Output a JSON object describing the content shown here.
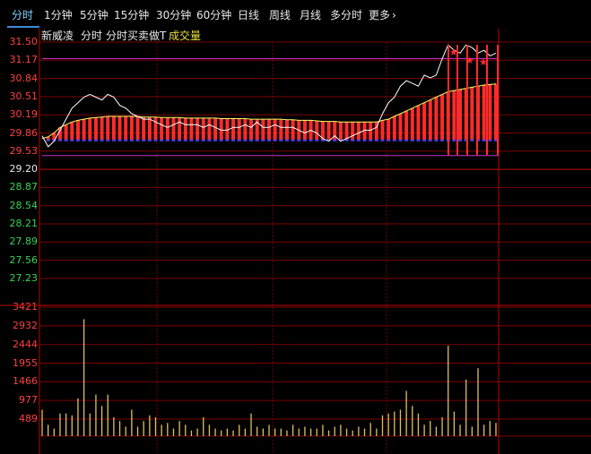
{
  "tabs": {
    "items": [
      "分时",
      "1分钟",
      "5分钟",
      "15分钟",
      "30分钟",
      "60分钟",
      "日线",
      "周线",
      "月线",
      "多分时",
      "更多"
    ],
    "active_index": 0,
    "more_arrow": "chevron-right-icon"
  },
  "info": {
    "stock_name": "新威凌",
    "view": "分时",
    "indicator": "分时买卖做T",
    "volume_label": "成交量"
  },
  "colors": {
    "up": "#ff2b2b",
    "down": "#39d353",
    "price_line": "#ffffff",
    "avg_line": "#ffff66",
    "grid": "#7a0000",
    "band": "#cc33cc",
    "volume": "#e0c060"
  },
  "price_axis": {
    "ticks": [
      "31.50",
      "31.17",
      "30.84",
      "30.51",
      "30.19",
      "29.86",
      "29.53",
      "29.20",
      "28.87",
      "28.54",
      "28.21",
      "27.89",
      "27.56",
      "27.23"
    ],
    "tick_colors": [
      "red",
      "red",
      "red",
      "red",
      "red",
      "red",
      "red",
      "white",
      "green",
      "green",
      "green",
      "green",
      "green",
      "green"
    ]
  },
  "volume_axis": {
    "ticks": [
      "3421",
      "2932",
      "2444",
      "1955",
      "1466",
      "977",
      "489"
    ]
  },
  "chart_data": {
    "type": "line",
    "title": "",
    "ylim_price": [
      27.0,
      31.5
    ],
    "ylim_volume": [
      0,
      3421
    ],
    "series": [
      {
        "values": [
          29.8,
          29.6,
          29.7,
          29.9,
          30.1,
          30.3,
          30.4,
          30.5,
          30.55,
          30.5,
          30.45,
          30.55,
          30.5,
          30.35,
          30.3,
          30.2,
          30.15,
          30.1,
          30.1,
          30.05,
          30.0,
          29.95,
          30.0,
          30.05,
          30.0,
          30.0,
          30.0,
          29.95,
          30.0,
          29.95,
          29.9,
          29.9,
          29.95,
          29.95,
          30.0,
          29.95,
          30.05,
          29.95,
          29.95,
          30.0,
          29.95,
          29.95,
          29.95,
          29.9,
          29.85,
          29.9,
          29.85,
          29.75,
          29.7,
          29.8,
          29.7,
          29.75,
          29.8,
          29.85,
          29.9,
          29.9,
          29.95,
          30.2,
          30.4,
          30.5,
          30.7,
          30.8,
          30.75,
          30.7,
          30.9,
          30.85,
          30.9,
          31.2,
          31.45,
          31.35,
          31.3,
          31.45,
          31.4,
          31.3,
          31.35,
          31.25,
          31.3
        ]
      },
      {
        "values": [
          29.75,
          29.78,
          29.85,
          29.95,
          30.0,
          30.05,
          30.08,
          30.1,
          30.12,
          30.13,
          30.14,
          30.15,
          30.15,
          30.15,
          30.15,
          30.15,
          30.15,
          30.14,
          30.14,
          30.14,
          30.13,
          30.13,
          30.13,
          30.13,
          30.12,
          30.12,
          30.12,
          30.12,
          30.12,
          30.12,
          30.11,
          30.11,
          30.11,
          30.11,
          30.11,
          30.1,
          30.1,
          30.1,
          30.1,
          30.1,
          30.1,
          30.09,
          30.09,
          30.08,
          30.08,
          30.08,
          30.07,
          30.06,
          30.06,
          30.06,
          30.05,
          30.05,
          30.05,
          30.05,
          30.05,
          30.05,
          30.05,
          30.08,
          30.1,
          30.15,
          30.2,
          30.25,
          30.3,
          30.35,
          30.4,
          30.45,
          30.5,
          30.55,
          30.6,
          30.62,
          30.64,
          30.66,
          30.68,
          30.7,
          30.72,
          30.73,
          30.74
        ]
      }
    ],
    "volume_values": [
      700,
      300,
      200,
      600,
      600,
      550,
      1000,
      3100,
      600,
      1100,
      800,
      1100,
      500,
      400,
      250,
      700,
      250,
      400,
      550,
      500,
      300,
      350,
      200,
      400,
      300,
      150,
      200,
      500,
      300,
      200,
      150,
      200,
      150,
      300,
      200,
      600,
      250,
      200,
      300,
      200,
      200,
      150,
      300,
      200,
      250,
      200,
      200,
      300,
      150,
      250,
      300,
      200,
      150,
      250,
      200,
      350,
      200,
      550,
      600,
      650,
      700,
      1200,
      800,
      600,
      300,
      400,
      250,
      500,
      2400,
      650,
      300,
      1500,
      250,
      1800,
      300,
      400,
      350
    ]
  }
}
